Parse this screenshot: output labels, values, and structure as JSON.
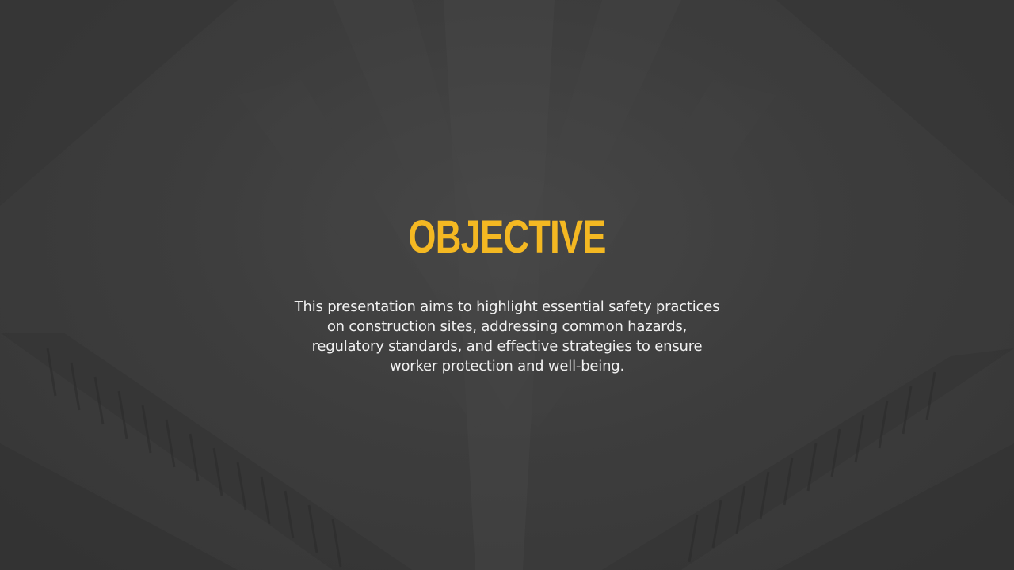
{
  "slide": {
    "title": "OBJECTIVE",
    "body": "This presentation aims to highlight essential safety practices on construction sites, addressing common hazards, regulatory standards, and effective strategies to ensure worker protection and well-being."
  },
  "colors": {
    "background": "#3a3a3a",
    "title": "#f4b822",
    "body_text": "#f1f1f1"
  }
}
